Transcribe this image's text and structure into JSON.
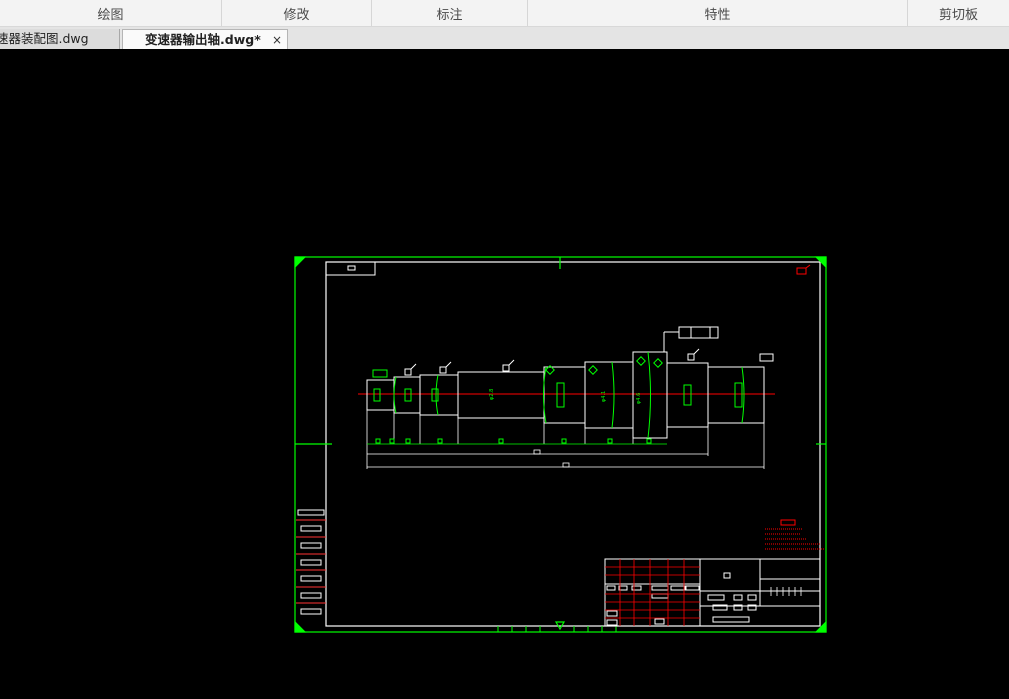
{
  "ribbon": {
    "panels": [
      {
        "label": "绘图"
      },
      {
        "label": "修改"
      },
      {
        "label": "标注"
      },
      {
        "label": "特性"
      },
      {
        "label": "剪切板"
      }
    ]
  },
  "tabs": [
    {
      "label": "速器装配图.dwg"
    },
    {
      "label": "变速器输出轴.dwg*",
      "close": "×"
    }
  ],
  "colors": {
    "canvas": "#000000",
    "frame": "#00ff00",
    "part": "#ffffff",
    "centerline": "#ff0000"
  },
  "drawing": {
    "dims": [
      "φ2.8",
      "φ4.1",
      "φ4.6"
    ]
  }
}
